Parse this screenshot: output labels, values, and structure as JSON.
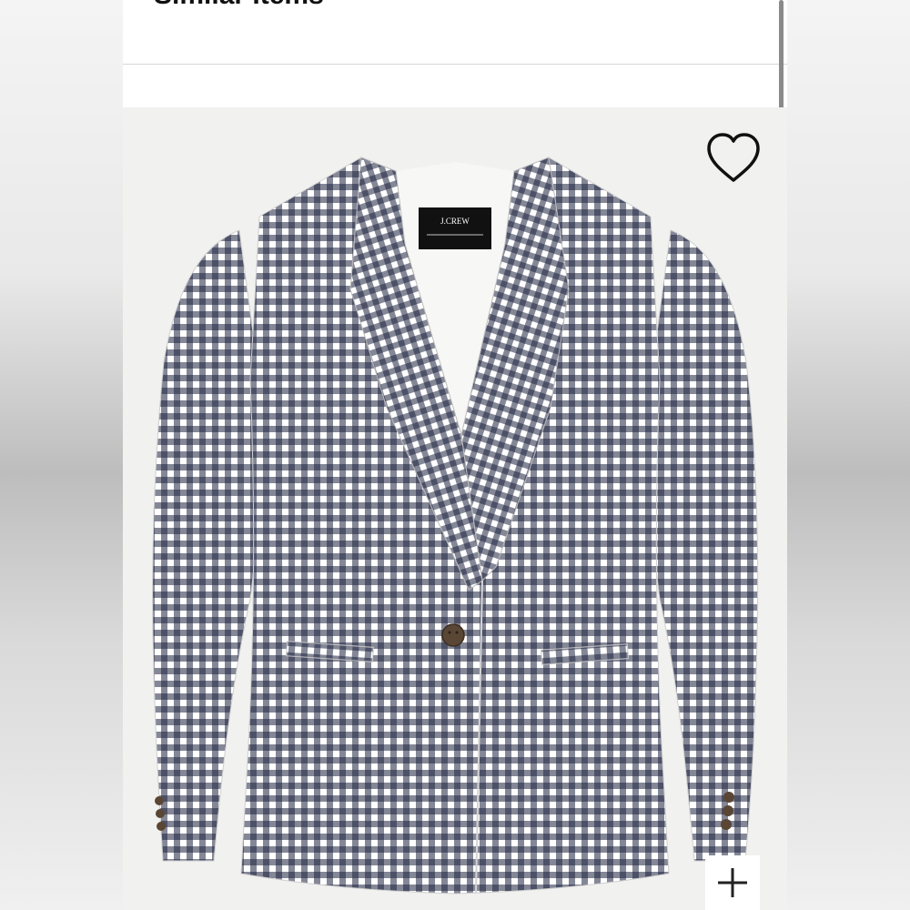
{
  "header": {
    "title": "Similar Items"
  },
  "product": {
    "brand_label": "J.CREW",
    "image_icon": "checked-blazer-image",
    "wishlist_icon": "heart-outline-icon",
    "zoom_icon": "plus-icon"
  },
  "colors": {
    "check_dark": "#1f2540",
    "check_light": "#ffffff",
    "card_background": "#f1f1ef",
    "button_wood": "#5a4634"
  }
}
